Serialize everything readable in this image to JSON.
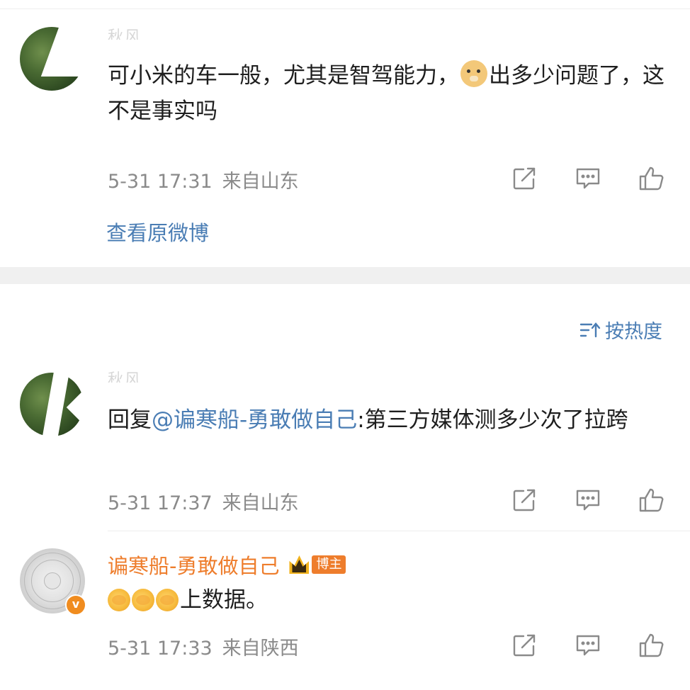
{
  "comment1": {
    "username": "秋风",
    "text": "可小米的车一般，尤其是智驾能力，",
    "text_after_emoji": "出多少问题了，这不是事实吗",
    "emoji": "doge-emoji",
    "time": "5-31 17:31",
    "location": "来自山东"
  },
  "view_original": "查看原微博",
  "sort": {
    "label": "按热度",
    "icon": "sort-icon"
  },
  "comment2": {
    "username": "秋风",
    "reply_prefix": "回复",
    "mention": "@谝寒船-勇敢做自己",
    "text": ":第三方媒体测多少次了拉跨",
    "time": "5-31 17:37",
    "location": "来自山东"
  },
  "comment3": {
    "username": "谝寒船-勇敢做自己",
    "badge": "博主",
    "text": "上数据。",
    "time": "5-31 17:33",
    "location": "来自陕西",
    "verified": "v"
  },
  "colors": {
    "link": "#4a7db4",
    "meta": "#8a8a8a",
    "orange": "#ee7d2c"
  }
}
